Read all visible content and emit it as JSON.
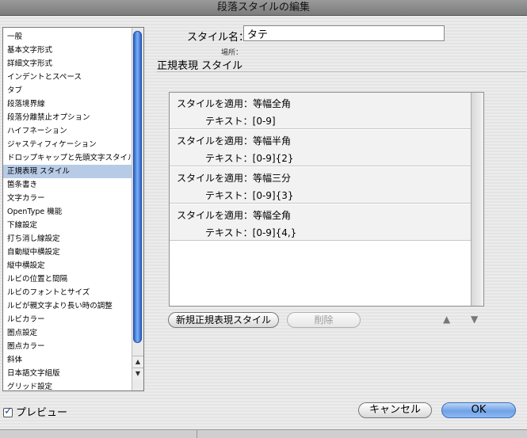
{
  "window": {
    "title": "段落スタイルの編集"
  },
  "categories": [
    {
      "label": "一般",
      "selected": false
    },
    {
      "label": "基本文字形式",
      "selected": false
    },
    {
      "label": "詳細文字形式",
      "selected": false
    },
    {
      "label": "インデントとスペース",
      "selected": false
    },
    {
      "label": "タブ",
      "selected": false
    },
    {
      "label": "段落境界線",
      "selected": false
    },
    {
      "label": "段落分離禁止オプション",
      "selected": false
    },
    {
      "label": "ハイフネーション",
      "selected": false
    },
    {
      "label": "ジャスティフィケーション",
      "selected": false
    },
    {
      "label": "ドロップキャップと先頭文字スタイル",
      "selected": false
    },
    {
      "label": "正規表現 スタイル",
      "selected": true
    },
    {
      "label": "箇条書き",
      "selected": false
    },
    {
      "label": "文字カラー",
      "selected": false
    },
    {
      "label": "OpenType 機能",
      "selected": false
    },
    {
      "label": "下線設定",
      "selected": false
    },
    {
      "label": "打ち消し線設定",
      "selected": false
    },
    {
      "label": "自動縦中横設定",
      "selected": false
    },
    {
      "label": "縦中横設定",
      "selected": false
    },
    {
      "label": "ルビの位置と間隔",
      "selected": false
    },
    {
      "label": "ルビのフォントとサイズ",
      "selected": false
    },
    {
      "label": "ルビが親文字より長い時の調整",
      "selected": false
    },
    {
      "label": "ルビカラー",
      "selected": false
    },
    {
      "label": "圏点設定",
      "selected": false
    },
    {
      "label": "圏点カラー",
      "selected": false
    },
    {
      "label": "斜体",
      "selected": false
    },
    {
      "label": "日本語文字組版",
      "selected": false
    },
    {
      "label": "グリッド設定",
      "selected": false
    }
  ],
  "style_name": {
    "label": "スタイル名：",
    "value": "タテ"
  },
  "location": {
    "label": "場所："
  },
  "section": {
    "title": "正規表現 スタイル"
  },
  "rules": [
    {
      "apply": "スタイルを適用：等幅全角",
      "text": "テキスト：[0-9]"
    },
    {
      "apply": "スタイルを適用：等幅半角",
      "text": "テキスト：[0-9]{2}"
    },
    {
      "apply": "スタイルを適用：等幅三分",
      "text": "テキスト：[0-9]{3}"
    },
    {
      "apply": "スタイルを適用：等幅全角",
      "text": "テキスト：[0-9]{4,}"
    }
  ],
  "buttons": {
    "new_rule": "新規正規表現スタイル",
    "delete": "削除",
    "move_up": "▲",
    "move_down": "▼",
    "cancel": "キャンセル",
    "ok": "OK"
  },
  "preview": {
    "label": "プレビュー",
    "checked": true
  },
  "list_scroll": {
    "up": "▲",
    "down": "▼"
  },
  "colors": {
    "accent": "#6fa2e6",
    "selection": "#b7cbe6"
  }
}
